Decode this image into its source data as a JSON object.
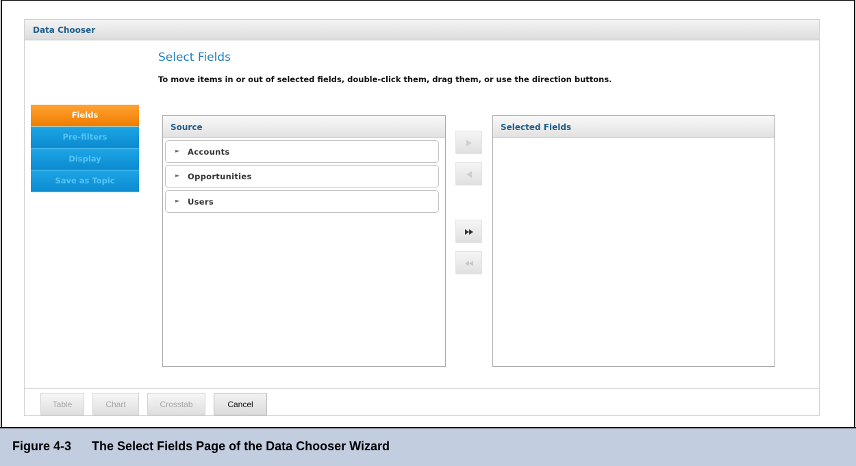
{
  "dialog": {
    "title": "Data Chooser",
    "heading": "Select Fields",
    "instructions": "To move items in or out of selected fields, double-click them, drag them, or use the direction buttons."
  },
  "steps": [
    {
      "label": "Fields",
      "active": true
    },
    {
      "label": "Pre-filters",
      "active": false
    },
    {
      "label": "Display",
      "active": false
    },
    {
      "label": "Save as Topic",
      "active": false
    }
  ],
  "source_panel": {
    "title": "Source",
    "items": [
      {
        "label": "Accounts",
        "icon": "caret-right-icon"
      },
      {
        "label": "Opportunities",
        "icon": "caret-right-icon"
      },
      {
        "label": "Users",
        "icon": "caret-right-icon"
      }
    ]
  },
  "selected_panel": {
    "title": "Selected Fields",
    "items": []
  },
  "direction_buttons": [
    {
      "name": "move-right",
      "icon": "triangle-right-icon",
      "enabled": false
    },
    {
      "name": "move-left",
      "icon": "triangle-left-icon",
      "enabled": false
    },
    {
      "name": "move-all-right",
      "icon": "double-arrow-right-icon",
      "enabled": true
    },
    {
      "name": "move-all-left",
      "icon": "double-arrow-left-icon",
      "enabled": false
    }
  ],
  "footer_buttons": [
    {
      "label": "Table",
      "enabled": false
    },
    {
      "label": "Chart",
      "enabled": false
    },
    {
      "label": "Crosstab",
      "enabled": false
    },
    {
      "label": "Cancel",
      "enabled": true
    }
  ],
  "caption": {
    "number": "Figure 4-3",
    "text": "The Select Fields Page of the Data Chooser Wizard"
  },
  "colors": {
    "accent_blue": "#1f7fbf",
    "active_step": "#f07d00",
    "inactive_step": "#0b8ad0",
    "caption_bg": "#c3cde0"
  }
}
